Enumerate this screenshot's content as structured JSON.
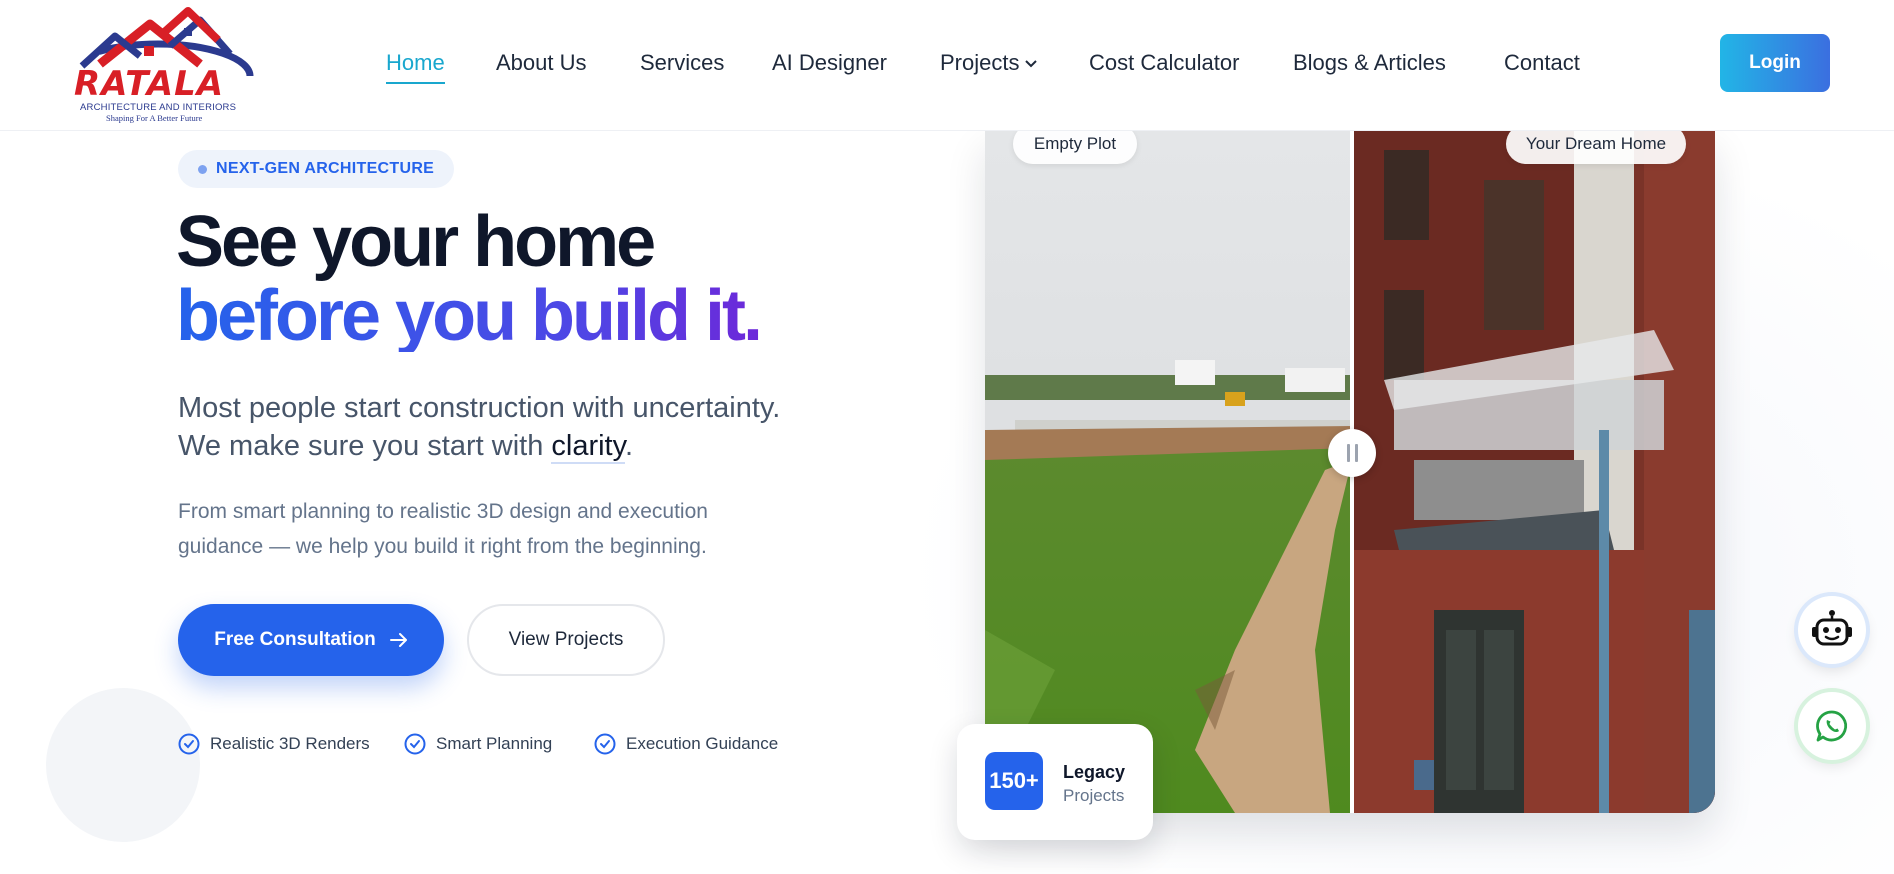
{
  "logo": {
    "name": "RATALA",
    "tagline": "ARCHITECTURE AND INTERIORS",
    "slogan": "Shaping For A Better Future"
  },
  "nav": {
    "items": [
      {
        "label": "Home",
        "active": true
      },
      {
        "label": "About Us"
      },
      {
        "label": "Services"
      },
      {
        "label": "AI Designer"
      },
      {
        "label": "Projects",
        "has_dropdown": true
      },
      {
        "label": "Cost Calculator"
      },
      {
        "label": "Blogs & Articles"
      },
      {
        "label": "Contact"
      }
    ],
    "login_label": "Login"
  },
  "hero": {
    "badge": "NEXT-GEN ARCHITECTURE",
    "title_line1": "See your home",
    "title_line2": "before you build it.",
    "lead_line1": "Most people start construction with uncertainty.",
    "lead_line2_prefix": "We make sure you start with ",
    "lead_line2_highlight": "clarity",
    "lead_line2_suffix": ".",
    "desc_line1": "From smart planning to realistic 3D design and execution",
    "desc_line2": "guidance — we help you build it right from the beginning.",
    "primary_button": "Free Consultation",
    "secondary_button": "View Projects",
    "features": [
      "Realistic 3D Renders",
      "Smart Planning",
      "Execution Guidance"
    ]
  },
  "compare": {
    "left_label": "Empty Plot",
    "right_label": "Your Dream Home"
  },
  "stat": {
    "value": "150+",
    "title": "Legacy",
    "subtitle": "Projects"
  },
  "colors": {
    "accent": "#2563eb",
    "nav_active": "#19a7ce",
    "logo_red": "#d81f26",
    "logo_blue": "#2b3a8f"
  }
}
